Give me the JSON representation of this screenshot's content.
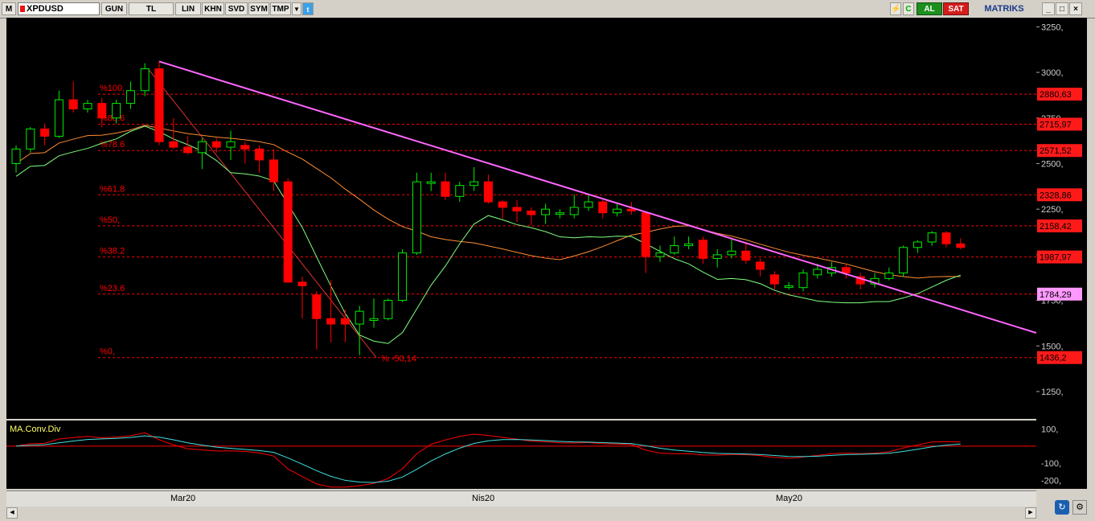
{
  "toolbar": {
    "logo": "M",
    "symbol": "XPDUSD",
    "buttons": [
      "GUN",
      "TL",
      "LIN",
      "KHN",
      "SVD",
      "SYM",
      "TMP"
    ],
    "buy_label": "AL",
    "sell_label": "SAT",
    "brand": "MATRIKS"
  },
  "price_axis": {
    "ticks": [
      "3250,",
      "3000,",
      "2750,",
      "2500,",
      "2250,",
      "2000,",
      "1750,",
      "1500,",
      "1250,"
    ],
    "badges": [
      {
        "value": "2880,63",
        "bg": "#ff1a1a",
        "fg": "#000000"
      },
      {
        "value": "2715,97",
        "bg": "#ff1a1a",
        "fg": "#000000"
      },
      {
        "value": "2571,52",
        "bg": "#ff1a1a",
        "fg": "#000000"
      },
      {
        "value": "2328,86",
        "bg": "#ff1a1a",
        "fg": "#000000"
      },
      {
        "value": "2158,42",
        "bg": "#ff1a1a",
        "fg": "#000000"
      },
      {
        "value": "1987,97",
        "bg": "#ff1a1a",
        "fg": "#000000"
      },
      {
        "value": "1784,29",
        "bg": "#ff99ff",
        "fg": "#000000"
      },
      {
        "value": "1436,2",
        "bg": "#ff1a1a",
        "fg": "#000000"
      }
    ]
  },
  "fib_levels": [
    {
      "label": "%100,",
      "price": 2880.63
    },
    {
      "label": "%88.6",
      "price": 2715.97
    },
    {
      "label": "%78.6",
      "price": 2571.52
    },
    {
      "label": "%61.8",
      "price": 2328.86
    },
    {
      "label": "%50,",
      "price": 2158.42
    },
    {
      "label": "%38.2",
      "price": 1987.97
    },
    {
      "label": "%23.6",
      "price": 1784.29
    },
    {
      "label": "%0,",
      "price": 1436.2
    }
  ],
  "diagonal_label": "% -50,14",
  "oscillator": {
    "title": "MA.Conv.Div",
    "ticks": [
      "100,",
      "-100,",
      "-200,"
    ]
  },
  "dates": [
    "Mar20",
    "Nis20",
    "May20"
  ],
  "colors": {
    "up": "#00ee00",
    "down": "#ff0000",
    "ma_fast": "#7fff7f",
    "ma_slow": "#ff8c33",
    "trendline": "#ff66ff",
    "fib": "#ff0000",
    "macd": "#40e0e0",
    "signal": "#ff0000"
  },
  "chart_data": {
    "type": "candlestick",
    "ylim": [
      1100,
      3300
    ],
    "candles": [
      [
        2500,
        2600,
        2450,
        2580
      ],
      [
        2580,
        2700,
        2560,
        2690
      ],
      [
        2690,
        2720,
        2600,
        2650
      ],
      [
        2650,
        2900,
        2640,
        2850
      ],
      [
        2850,
        2950,
        2780,
        2800
      ],
      [
        2800,
        2850,
        2780,
        2830
      ],
      [
        2830,
        2860,
        2700,
        2750
      ],
      [
        2750,
        2850,
        2720,
        2830
      ],
      [
        2830,
        2950,
        2800,
        2900
      ],
      [
        2900,
        3050,
        2870,
        3020
      ],
      [
        3020,
        3060,
        2600,
        2620
      ],
      [
        2620,
        2750,
        2580,
        2590
      ],
      [
        2590,
        2650,
        2550,
        2560
      ],
      [
        2560,
        2640,
        2470,
        2620
      ],
      [
        2620,
        2640,
        2560,
        2590
      ],
      [
        2590,
        2680,
        2520,
        2620
      ],
      [
        2600,
        2620,
        2500,
        2580
      ],
      [
        2580,
        2600,
        2450,
        2520
      ],
      [
        2520,
        2580,
        2350,
        2400
      ],
      [
        2400,
        2420,
        1850,
        1850
      ],
      [
        1850,
        1880,
        1650,
        1830
      ],
      [
        1780,
        1800,
        1480,
        1650
      ],
      [
        1650,
        1860,
        1520,
        1620
      ],
      [
        1650,
        1700,
        1520,
        1620
      ],
      [
        1620,
        1720,
        1450,
        1690
      ],
      [
        1640,
        1760,
        1600,
        1650
      ],
      [
        1650,
        1760,
        1640,
        1750
      ],
      [
        1750,
        2030,
        1740,
        2010
      ],
      [
        2010,
        2450,
        2000,
        2400
      ],
      [
        2400,
        2450,
        2350,
        2400
      ],
      [
        2400,
        2450,
        2300,
        2320
      ],
      [
        2320,
        2400,
        2290,
        2380
      ],
      [
        2380,
        2480,
        2350,
        2400
      ],
      [
        2400,
        2440,
        2280,
        2290
      ],
      [
        2290,
        2300,
        2200,
        2260
      ],
      [
        2260,
        2300,
        2180,
        2240
      ],
      [
        2240,
        2260,
        2160,
        2220
      ],
      [
        2220,
        2280,
        2170,
        2250
      ],
      [
        2230,
        2250,
        2200,
        2230
      ],
      [
        2220,
        2330,
        2200,
        2260
      ],
      [
        2260,
        2330,
        2240,
        2290
      ],
      [
        2290,
        2300,
        2200,
        2230
      ],
      [
        2230,
        2280,
        2210,
        2250
      ],
      [
        2250,
        2290,
        2220,
        2240
      ],
      [
        2230,
        2240,
        1900,
        1990
      ],
      [
        1990,
        2050,
        1960,
        2010
      ],
      [
        2010,
        2100,
        2000,
        2050
      ],
      [
        2050,
        2100,
        2030,
        2060
      ],
      [
        2080,
        2100,
        1950,
        1980
      ],
      [
        1980,
        2030,
        1930,
        2000
      ],
      [
        2000,
        2090,
        1980,
        2020
      ],
      [
        2020,
        2070,
        1950,
        1970
      ],
      [
        1960,
        1980,
        1880,
        1920
      ],
      [
        1890,
        1910,
        1810,
        1840
      ],
      [
        1830,
        1850,
        1810,
        1830
      ],
      [
        1820,
        1920,
        1800,
        1900
      ],
      [
        1890,
        1950,
        1870,
        1920
      ],
      [
        1900,
        1960,
        1880,
        1930
      ],
      [
        1930,
        1950,
        1870,
        1900
      ],
      [
        1880,
        1900,
        1810,
        1840
      ],
      [
        1840,
        1900,
        1820,
        1870
      ],
      [
        1870,
        1930,
        1860,
        1900
      ],
      [
        1900,
        2050,
        1880,
        2040
      ],
      [
        2040,
        2080,
        2010,
        2070
      ],
      [
        2070,
        2130,
        2050,
        2120
      ],
      [
        2120,
        2130,
        2040,
        2060
      ],
      [
        2060,
        2090,
        2030,
        2040
      ]
    ],
    "trendline": [
      [
        10,
        3060
      ],
      [
        66,
        1700
      ]
    ],
    "osc_range": [
      -250,
      150
    ]
  }
}
